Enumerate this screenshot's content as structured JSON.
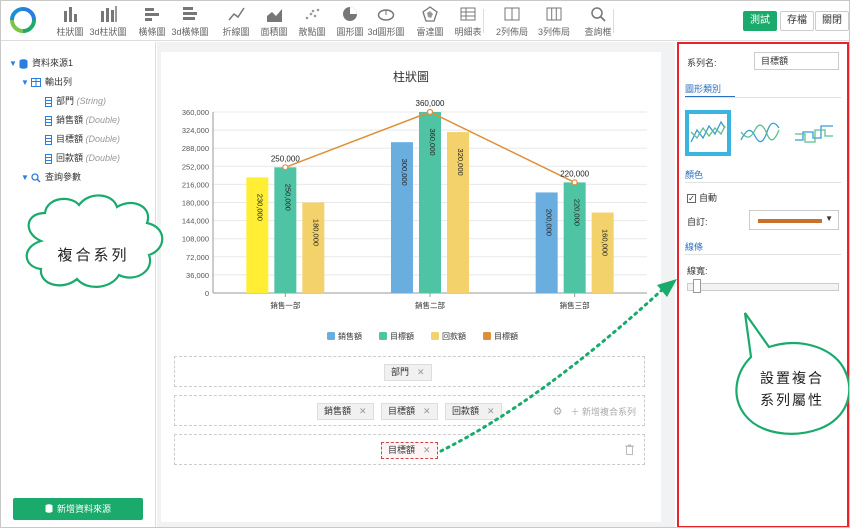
{
  "toolbar": {
    "items": [
      {
        "label": "柱狀圖",
        "icon": "bar-chart-icon"
      },
      {
        "label": "3d柱狀圖",
        "icon": "bar-3d-icon"
      },
      {
        "label": "橫條圖",
        "icon": "hbar-chart-icon"
      },
      {
        "label": "3d橫條圖",
        "icon": "hbar-3d-icon"
      },
      {
        "label": "折線圖",
        "icon": "line-chart-icon"
      },
      {
        "label": "面積圖",
        "icon": "area-chart-icon"
      },
      {
        "label": "散點圖",
        "icon": "scatter-chart-icon"
      },
      {
        "label": "圓形圖",
        "icon": "pie-chart-icon"
      },
      {
        "label": "3d圓形圖",
        "icon": "pie-3d-icon"
      },
      {
        "label": "雷達圖",
        "icon": "radar-chart-icon"
      },
      {
        "label": "明細表",
        "icon": "table-icon"
      },
      {
        "label": "2列佈局",
        "icon": "two-column-layout-icon"
      },
      {
        "label": "3列佈局",
        "icon": "three-column-layout-icon"
      },
      {
        "label": "查詢框",
        "icon": "search-icon"
      }
    ],
    "test_label": "測試",
    "save_label": "存檔",
    "close_label": "關閉"
  },
  "left_panel": {
    "datasource": "資料來源1",
    "output": "輸出列",
    "fields": [
      {
        "name": "部門",
        "type": "(String)"
      },
      {
        "name": "銷售額",
        "type": "(Double)"
      },
      {
        "name": "目標額",
        "type": "(Double)"
      },
      {
        "name": "回款額",
        "type": "(Double)"
      }
    ],
    "query_params": "查詢參數",
    "new_source_label": "新增資料來源"
  },
  "chart_data": {
    "type": "bar",
    "title": "柱狀圖",
    "categories": [
      "銷售一部",
      "銷售二部",
      "銷售三部"
    ],
    "series": [
      {
        "name": "銷售額",
        "type": "bar",
        "values": [
          230000,
          300000,
          200000
        ],
        "color": "#6aaee0"
      },
      {
        "name": "目標額",
        "type": "bar",
        "values": [
          250000,
          360000,
          220000
        ],
        "color": "#4fc4a4"
      },
      {
        "name": "回款額",
        "type": "bar",
        "values": [
          180000,
          320000,
          160000
        ],
        "color": "#f3d26b"
      },
      {
        "name": "目標額",
        "type": "line",
        "values": [
          250000,
          360000,
          220000
        ],
        "color": "#df8f3a"
      }
    ],
    "highlight_bar_color": "#ffee33",
    "ylim": [
      0,
      360000
    ],
    "yticks": [
      0,
      36000,
      72000,
      108000,
      144000,
      180000,
      216000,
      252000,
      288000,
      324000,
      360000
    ],
    "ytick_labels": [
      "0",
      "36,000",
      "72,000",
      "108,000",
      "144,000",
      "180,000",
      "216,000",
      "252,000",
      "288,000",
      "324,000",
      "360,000"
    ],
    "bar_labels": [
      [
        "230,000",
        "250,000",
        "180,000"
      ],
      [
        "300,000",
        "360,000",
        "320,000"
      ],
      [
        "200,000",
        "220,000",
        "160,000"
      ]
    ],
    "line_labels": [
      "250,000",
      "360,000",
      "220,000"
    ],
    "grid": true,
    "legend_position": "bottom"
  },
  "zones": {
    "category_chip": "部門",
    "series_chips": [
      "銷售額",
      "目標額",
      "回款額"
    ],
    "add_series_label": "新增複合系列",
    "combo_chip": "目標額"
  },
  "right_panel": {
    "series_name_label": "系列名:",
    "series_name_value": "目標額",
    "chart_type_section": "圖形類別",
    "color_section": "顏色",
    "auto_label": "自動",
    "custom_label": "自訂:",
    "custom_color": "#c9702a",
    "line_section": "線條",
    "line_width_label": "線寬:"
  },
  "callouts": {
    "cloud": "複合系列",
    "bubble_line1": "設置複合",
    "bubble_line2": "系列屬性"
  },
  "colors": {
    "accent": "#1aaa6c",
    "selection": "#39b5e0",
    "highlight_border": "#e8232c",
    "callout_border": "#1aaa6c"
  }
}
